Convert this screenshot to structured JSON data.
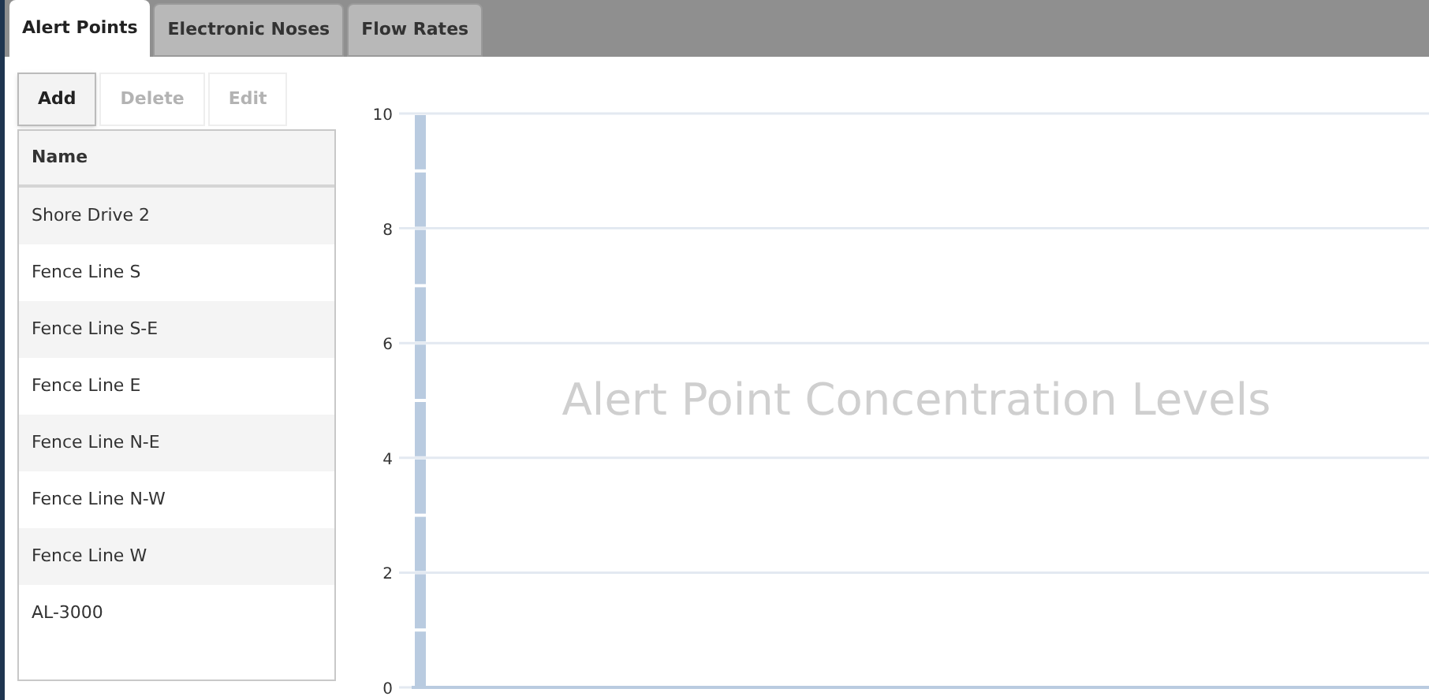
{
  "tabs": [
    {
      "label": "Alert Points",
      "selected": true
    },
    {
      "label": "Electronic Noses",
      "selected": false
    },
    {
      "label": "Flow Rates",
      "selected": false
    }
  ],
  "toolbar": [
    {
      "label": "Add",
      "disabled": false
    },
    {
      "label": "Delete",
      "disabled": true
    },
    {
      "label": "Edit",
      "disabled": true
    }
  ],
  "table": {
    "columns": [
      "Name"
    ],
    "rows": [
      "Shore Drive 2",
      "Fence Line S",
      "Fence Line S-E",
      "Fence Line E",
      "Fence Line N-E",
      "Fence Line N-W",
      "Fence Line W",
      "AL-3000"
    ]
  },
  "chart": {
    "title": "Alert Point Concentration Levels",
    "y_ticks": [
      "10",
      "8",
      "6",
      "4",
      "2",
      "0"
    ]
  }
}
